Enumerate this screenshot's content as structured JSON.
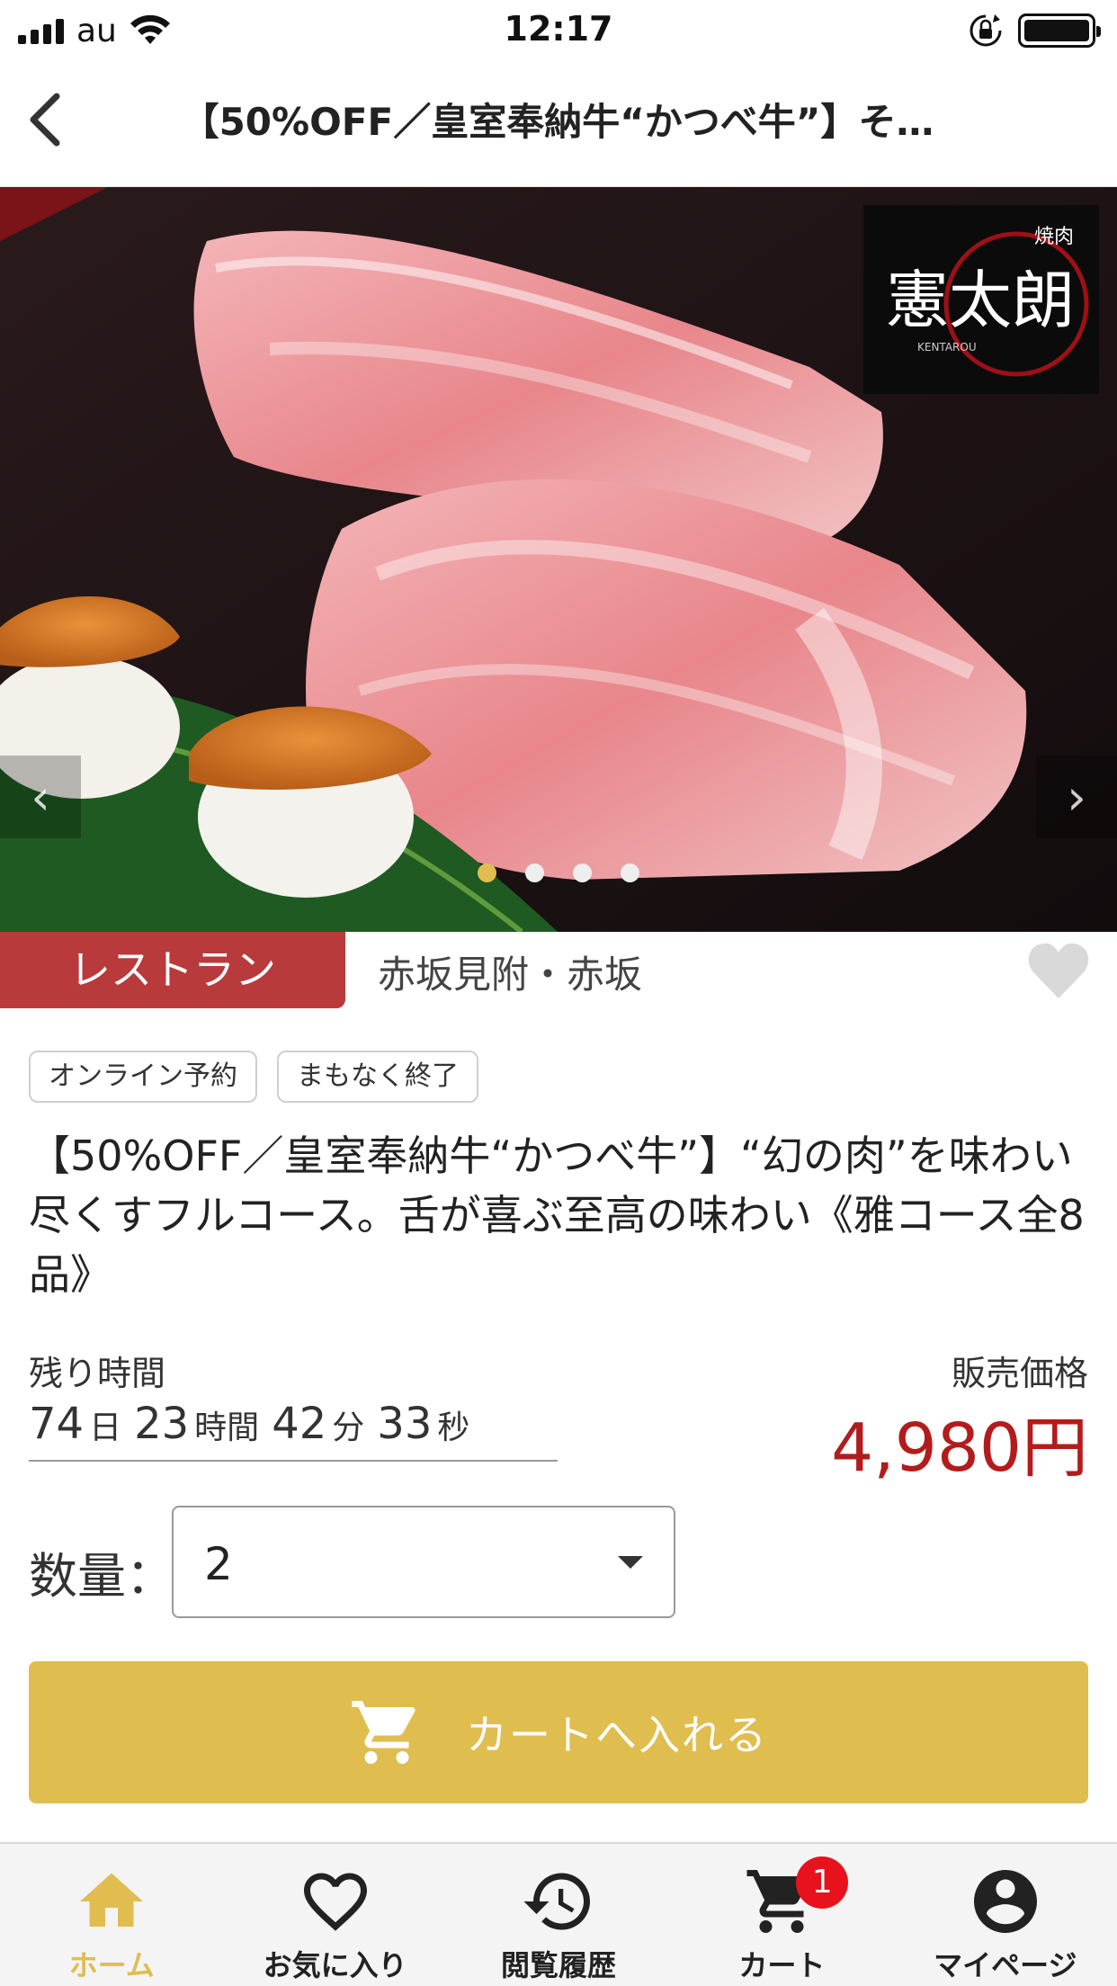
{
  "status_bar": {
    "carrier": "au",
    "time": "12:17"
  },
  "nav": {
    "title": "【50%OFF／皇室奉納牛“かつべ牛”】そ…"
  },
  "hero": {
    "logo_text": "憲太朗",
    "logo_sub": "焼肉",
    "logo_roman": "KENTAROU",
    "slide_count": 4,
    "active_slide": 1,
    "prev_glyph": "‹",
    "next_glyph": "›"
  },
  "category": {
    "label": "レストラン",
    "area": "赤坂見附・赤坂"
  },
  "badges": [
    "オンライン予約",
    "まもなく終了"
  ],
  "product": {
    "title": "【50%OFF／皇室奉納牛“かつべ牛”】“幻の肉”を味わい尽くすフルコース。舌が喜ぶ至高の味わい《雅コース全8品》"
  },
  "timer": {
    "label": "残り時間",
    "days": "74",
    "days_unit": "日",
    "hours": "23",
    "hours_unit": "時間",
    "minutes": "42",
    "minutes_unit": "分",
    "seconds": "33",
    "seconds_unit": "秒"
  },
  "price": {
    "label": "販売価格",
    "value": "4,980円",
    "color": "#b31c1c"
  },
  "quantity": {
    "label": "数量：",
    "value": "2"
  },
  "cart_button": {
    "label": "カートへ入れる",
    "icon": "cart-icon",
    "color": "#e0bd4f"
  },
  "tabbar": {
    "accent": "#e1bd4f",
    "items": [
      {
        "label": "ホーム",
        "icon": "home-icon",
        "active": true
      },
      {
        "label": "お気に入り",
        "icon": "heart-icon",
        "active": false
      },
      {
        "label": "閲覧履歴",
        "icon": "history-icon",
        "active": false
      },
      {
        "label": "カート",
        "icon": "cart-icon",
        "active": false,
        "badge": "1"
      },
      {
        "label": "マイページ",
        "icon": "account-icon",
        "active": false
      }
    ]
  }
}
